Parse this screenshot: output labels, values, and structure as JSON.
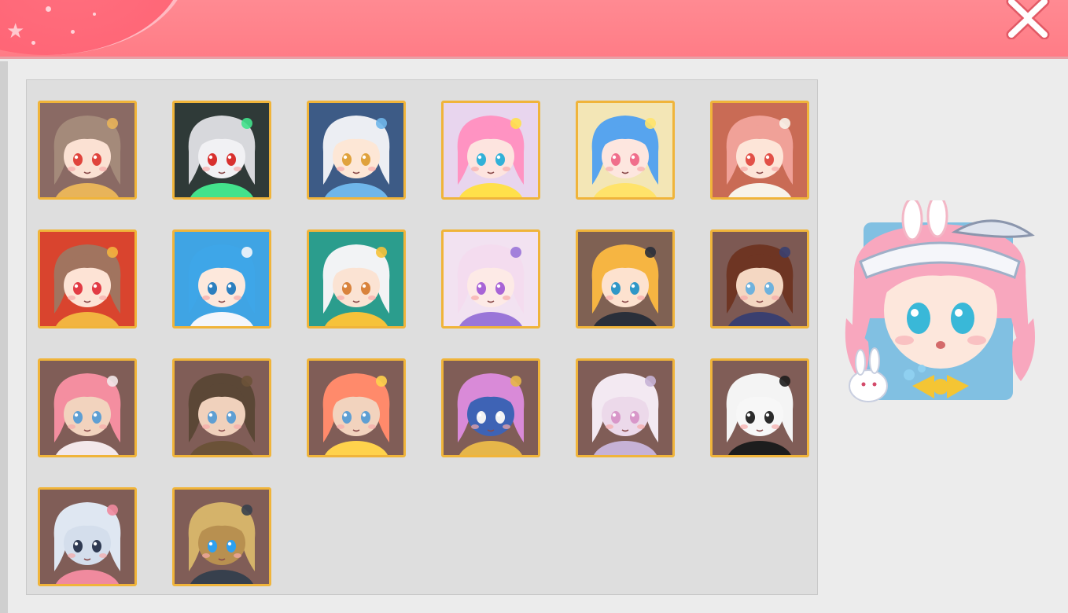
{
  "window": {
    "close_icon": "close-icon",
    "header_color": "#ff7c86"
  },
  "avatars": [
    {
      "name": "avatar-brown-hair-girl",
      "bg": "#8a6a64",
      "hair": "#a48a7a",
      "skin": "#fbe1d3",
      "eye": "#e0443c",
      "accent": "#e8b45a"
    },
    {
      "name": "avatar-dark-armor",
      "bg": "#2f3a38",
      "hair": "#d7d8dc",
      "skin": "#f1f1f4",
      "eye": "#d8302e",
      "accent": "#43e28c"
    },
    {
      "name": "avatar-silver-hair-boy",
      "bg": "#3d5b86",
      "hair": "#eceef3",
      "skin": "#fde7d6",
      "eye": "#e0a23c",
      "accent": "#6fb6ea"
    },
    {
      "name": "avatar-pink-angel-girl",
      "bg": "#e8d5ee",
      "hair": "#ff93c2",
      "skin": "#fde4df",
      "eye": "#32b1d8",
      "accent": "#ffe04a"
    },
    {
      "name": "avatar-blue-angel-girl",
      "bg": "#f3e6b6",
      "hair": "#57a4ee",
      "skin": "#fde6df",
      "eye": "#f06e8b",
      "accent": "#ffe36a"
    },
    {
      "name": "avatar-cow-hood-girl",
      "bg": "#c96b55",
      "hair": "#f0a198",
      "skin": "#fde5d8",
      "eye": "#e25047",
      "accent": "#f8f3ea"
    },
    {
      "name": "avatar-red-festive-girl",
      "bg": "#d9442e",
      "hair": "#a1745f",
      "skin": "#fde3d5",
      "eye": "#e23b44",
      "accent": "#f2b440"
    },
    {
      "name": "avatar-ocean-flower-girl",
      "bg": "#3fa4e4",
      "hair": "#3ea6e8",
      "skin": "#fde8dc",
      "eye": "#2c7fbf",
      "accent": "#f4f6fb"
    },
    {
      "name": "avatar-goggles-boy",
      "bg": "#2b9d8d",
      "hair": "#f2f3f5",
      "skin": "#fbe3d3",
      "eye": "#d9833c",
      "accent": "#f6c23a"
    },
    {
      "name": "avatar-bunny-pastel-girl",
      "bg": "#f2e2f1",
      "hair": "#f4dcef",
      "skin": "#fdeae6",
      "eye": "#a864d6",
      "accent": "#9a76d8"
    },
    {
      "name": "avatar-blonde-captain-boy",
      "bg": "#7f6153",
      "hair": "#f6b542",
      "skin": "#fde2cf",
      "eye": "#2f97c7",
      "accent": "#2a2f3a"
    },
    {
      "name": "avatar-scarf-block-girl",
      "bg": "#7d5953",
      "hair": "#6e3523",
      "skin": "#f4d7c2",
      "eye": "#6fb2dd",
      "accent": "#3a3f6f"
    },
    {
      "name": "avatar-pink-beret-block",
      "bg": "#805d57",
      "hair": "#f48ea0",
      "skin": "#f2d3be",
      "eye": "#5f9fd3",
      "accent": "#f3e8ea"
    },
    {
      "name": "avatar-newsboy-cap-block",
      "bg": "#805d57",
      "hair": "#5b4736",
      "skin": "#f0d1bc",
      "eye": "#5f9fd3",
      "accent": "#6b5238"
    },
    {
      "name": "avatar-orange-buns-block",
      "bg": "#805d57",
      "hair": "#ff8a6b",
      "skin": "#f2d3be",
      "eye": "#5f9fd3",
      "accent": "#ffd24c"
    },
    {
      "name": "avatar-bell-mount",
      "bg": "#805d57",
      "hair": "#d98ad8",
      "skin": "#3e63b5",
      "eye": "#f2f2f4",
      "accent": "#e6b64a"
    },
    {
      "name": "avatar-paper-crane",
      "bg": "#805d57",
      "hair": "#f3e9f2",
      "skin": "#ecd9ea",
      "eye": "#d897c9",
      "accent": "#c6b2d6"
    },
    {
      "name": "avatar-sailor-bear-block",
      "bg": "#805d57",
      "hair": "#f4f4f4",
      "skin": "#f7f7f7",
      "eye": "#2b2b2b",
      "accent": "#1d1d1d"
    },
    {
      "name": "avatar-elephant-mount",
      "bg": "#805d57",
      "hair": "#dfe7f2",
      "skin": "#d4deec",
      "eye": "#2f3a52",
      "accent": "#f08a9e"
    },
    {
      "name": "avatar-mech-horse",
      "bg": "#805d57",
      "hair": "#d5b36a",
      "skin": "#b89050",
      "eye": "#2ea0f0",
      "accent": "#37404d"
    }
  ],
  "selected_preview": {
    "name": "preview-bunny-sailor-girl",
    "hair": "#f8a7be",
    "skin": "#fde7dc",
    "eye": "#39b8d8",
    "hat": "#f5f6fa",
    "ribbon": "#f4c534",
    "frame": "#6fb9e0"
  }
}
